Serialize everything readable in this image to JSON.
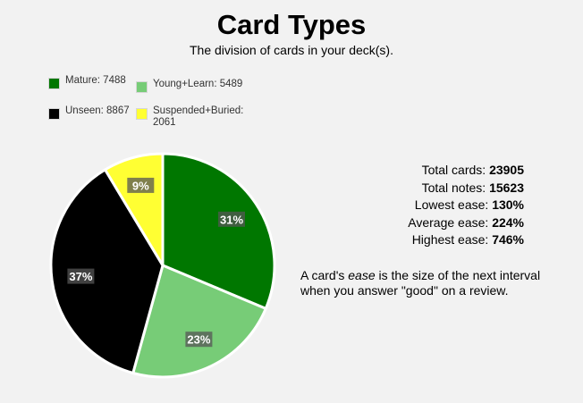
{
  "header": {
    "title": "Card Types",
    "subtitle": "The division of cards in your deck(s)."
  },
  "legend": [
    {
      "label": "Mature: 7488",
      "color": "#007700"
    },
    {
      "label": "Young+Learn: 5489",
      "color": "#77cc77"
    },
    {
      "label": "Unseen: 8867",
      "color": "#000000"
    },
    {
      "label": "Suspended+Buried: 2061",
      "color": "#ffff33"
    }
  ],
  "chart_data": {
    "type": "pie",
    "title": "Card Types",
    "subtitle": "The division of cards in your deck(s).",
    "categories": [
      "Mature",
      "Young+Learn",
      "Unseen",
      "Suspended+Buried"
    ],
    "values": [
      7488,
      5489,
      8867,
      2061
    ],
    "percent_labels": [
      "31%",
      "23%",
      "37%",
      "9%"
    ],
    "colors": [
      "#007700",
      "#77cc77",
      "#000000",
      "#ffff33"
    ],
    "legend_position": "top-left"
  },
  "stats": [
    {
      "label": "Total cards:",
      "value": "23905"
    },
    {
      "label": "Total notes:",
      "value": "15623"
    },
    {
      "label": "Lowest ease:",
      "value": "130%"
    },
    {
      "label": "Average ease:",
      "value": "224%"
    },
    {
      "label": "Highest ease:",
      "value": "746%"
    }
  ],
  "note": {
    "prefix": "A card's",
    "emphasis": "ease",
    "suffix": "is the size of the next interval when you answer \"good\" on a review."
  }
}
